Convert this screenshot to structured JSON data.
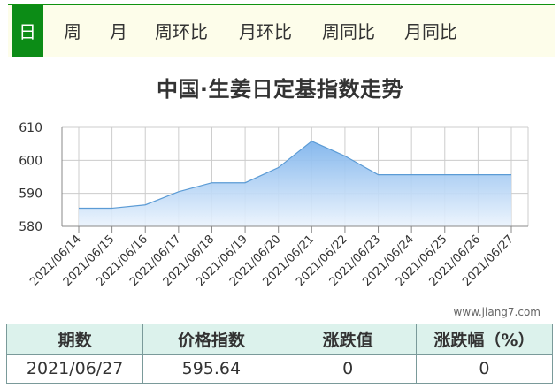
{
  "tabs": [
    {
      "label": "日",
      "active": true
    },
    {
      "label": "周",
      "active": false
    },
    {
      "label": "月",
      "active": false
    },
    {
      "label": "周环比",
      "active": false
    },
    {
      "label": "月环比",
      "active": false
    },
    {
      "label": "周同比",
      "active": false
    },
    {
      "label": "月同比",
      "active": false
    }
  ],
  "watermark": "www.jiang7.com",
  "summary": {
    "headers": [
      "期数",
      "价格指数",
      "涨跌值",
      "涨跌幅（%）"
    ],
    "row": [
      "2021/06/27",
      "595.64",
      "0",
      "0"
    ]
  },
  "colors": {
    "tab_active_bg": "#0c8c16",
    "line": "#5b9bd5",
    "area_top": "#7fb4ec",
    "area_bottom": "#eaf3fd",
    "grid": "#cccccc",
    "table_header_bg": "#dcf2ec"
  },
  "chart_data": {
    "type": "area",
    "title": "中国·生姜日定基指数走势",
    "xlabel": "",
    "ylabel": "",
    "categories": [
      "2021/06/14",
      "2021/06/15",
      "2021/06/16",
      "2021/06/17",
      "2021/06/18",
      "2021/06/19",
      "2021/06/20",
      "2021/06/21",
      "2021/06/22",
      "2021/06/23",
      "2021/06/24",
      "2021/06/25",
      "2021/06/26",
      "2021/06/27"
    ],
    "series": [
      {
        "values": [
          585.5,
          585.5,
          586.5,
          590.5,
          593.2,
          593.2,
          597.8,
          605.8,
          601.3,
          595.64,
          595.64,
          595.64,
          595.64,
          595.64
        ]
      }
    ],
    "ylim": [
      580,
      610
    ],
    "yticks": [
      580,
      590,
      600,
      610
    ],
    "grid": true,
    "legend": "none"
  }
}
